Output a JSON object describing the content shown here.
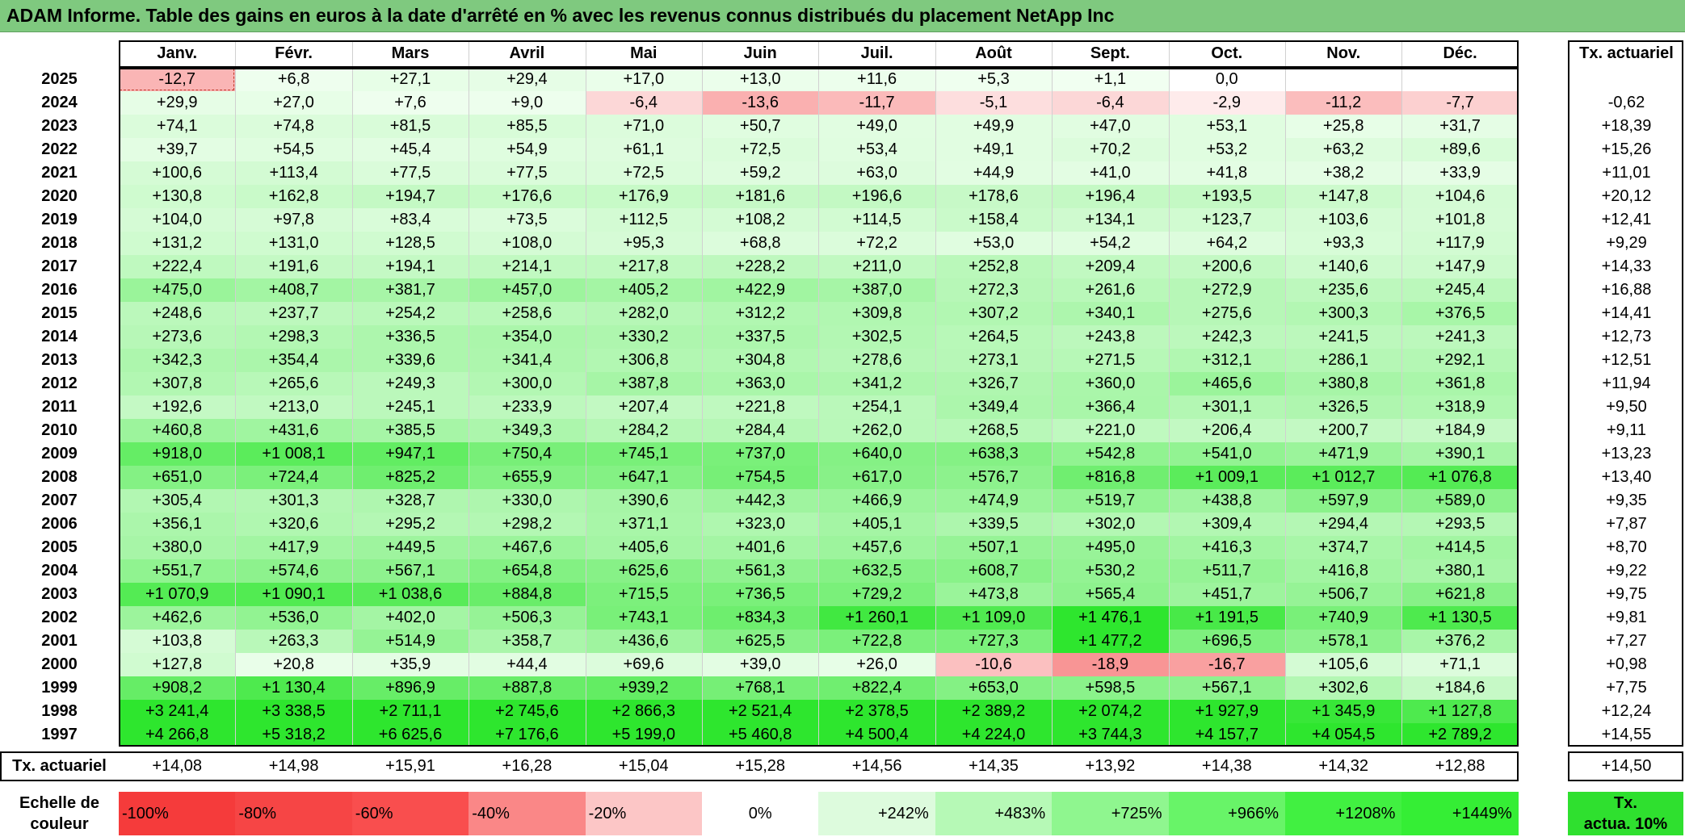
{
  "title": "ADAM Informe. Table des gains en euros à la date d'arrêté en % avec les revenus connus distribués du placement NetApp Inc",
  "months": [
    "Janv.",
    "Févr.",
    "Mars",
    "Avril",
    "Mai",
    "Juin",
    "Juil.",
    "Août",
    "Sept.",
    "Oct.",
    "Nov.",
    "Déc."
  ],
  "rate_header": "Tx. actuariel",
  "rows": [
    {
      "year": "2025",
      "values": [
        "-12,7",
        "+6,8",
        "+27,1",
        "+29,4",
        "+17,0",
        "+13,0",
        "+11,6",
        "+5,3",
        "+1,1",
        "0,0",
        "",
        ""
      ],
      "rate": ""
    },
    {
      "year": "2024",
      "values": [
        "+29,9",
        "+27,0",
        "+7,6",
        "+9,0",
        "-6,4",
        "-13,6",
        "-11,7",
        "-5,1",
        "-6,4",
        "-2,9",
        "-11,2",
        "-7,7"
      ],
      "rate": "-0,62"
    },
    {
      "year": "2023",
      "values": [
        "+74,1",
        "+74,8",
        "+81,5",
        "+85,5",
        "+71,0",
        "+50,7",
        "+49,0",
        "+49,9",
        "+47,0",
        "+53,1",
        "+25,8",
        "+31,7"
      ],
      "rate": "+18,39"
    },
    {
      "year": "2022",
      "values": [
        "+39,7",
        "+54,5",
        "+45,4",
        "+54,9",
        "+61,1",
        "+72,5",
        "+53,4",
        "+49,1",
        "+70,2",
        "+53,2",
        "+63,2",
        "+89,6"
      ],
      "rate": "+15,26"
    },
    {
      "year": "2021",
      "values": [
        "+100,6",
        "+113,4",
        "+77,5",
        "+77,5",
        "+72,5",
        "+59,2",
        "+63,0",
        "+44,9",
        "+41,0",
        "+41,8",
        "+38,2",
        "+33,9"
      ],
      "rate": "+11,01"
    },
    {
      "year": "2020",
      "values": [
        "+130,8",
        "+162,8",
        "+194,7",
        "+176,6",
        "+176,9",
        "+181,6",
        "+196,6",
        "+178,6",
        "+196,4",
        "+193,5",
        "+147,8",
        "+104,6"
      ],
      "rate": "+20,12"
    },
    {
      "year": "2019",
      "values": [
        "+104,0",
        "+97,8",
        "+83,4",
        "+73,5",
        "+112,5",
        "+108,2",
        "+114,5",
        "+158,4",
        "+134,1",
        "+123,7",
        "+103,6",
        "+101,8"
      ],
      "rate": "+12,41"
    },
    {
      "year": "2018",
      "values": [
        "+131,2",
        "+131,0",
        "+128,5",
        "+108,0",
        "+95,3",
        "+68,8",
        "+72,2",
        "+53,0",
        "+54,2",
        "+64,2",
        "+93,3",
        "+117,9"
      ],
      "rate": "+9,29"
    },
    {
      "year": "2017",
      "values": [
        "+222,4",
        "+191,6",
        "+194,1",
        "+214,1",
        "+217,8",
        "+228,2",
        "+211,0",
        "+252,8",
        "+209,4",
        "+200,6",
        "+140,6",
        "+147,9"
      ],
      "rate": "+14,33"
    },
    {
      "year": "2016",
      "values": [
        "+475,0",
        "+408,7",
        "+381,7",
        "+457,0",
        "+405,2",
        "+422,9",
        "+387,0",
        "+272,3",
        "+261,6",
        "+272,9",
        "+235,6",
        "+245,4"
      ],
      "rate": "+16,88"
    },
    {
      "year": "2015",
      "values": [
        "+248,6",
        "+237,7",
        "+254,2",
        "+258,6",
        "+282,0",
        "+312,2",
        "+309,8",
        "+307,2",
        "+340,1",
        "+275,6",
        "+300,3",
        "+376,5"
      ],
      "rate": "+14,41"
    },
    {
      "year": "2014",
      "values": [
        "+273,6",
        "+298,3",
        "+336,5",
        "+354,0",
        "+330,2",
        "+337,5",
        "+302,5",
        "+264,5",
        "+243,8",
        "+242,3",
        "+241,5",
        "+241,3"
      ],
      "rate": "+12,73"
    },
    {
      "year": "2013",
      "values": [
        "+342,3",
        "+354,4",
        "+339,6",
        "+341,4",
        "+306,8",
        "+304,8",
        "+278,6",
        "+273,1",
        "+271,5",
        "+312,1",
        "+286,1",
        "+292,1"
      ],
      "rate": "+12,51"
    },
    {
      "year": "2012",
      "values": [
        "+307,8",
        "+265,6",
        "+249,3",
        "+300,0",
        "+387,8",
        "+363,0",
        "+341,2",
        "+326,7",
        "+360,0",
        "+465,6",
        "+380,8",
        "+361,8"
      ],
      "rate": "+11,94"
    },
    {
      "year": "2011",
      "values": [
        "+192,6",
        "+213,0",
        "+245,1",
        "+233,9",
        "+207,4",
        "+221,8",
        "+254,1",
        "+349,4",
        "+366,4",
        "+301,1",
        "+326,5",
        "+318,9"
      ],
      "rate": "+9,50"
    },
    {
      "year": "2010",
      "values": [
        "+460,8",
        "+431,6",
        "+385,5",
        "+349,3",
        "+284,2",
        "+284,4",
        "+262,0",
        "+268,5",
        "+221,0",
        "+206,4",
        "+200,7",
        "+184,9"
      ],
      "rate": "+9,11"
    },
    {
      "year": "2009",
      "values": [
        "+918,0",
        "+1 008,1",
        "+947,1",
        "+750,4",
        "+745,1",
        "+737,0",
        "+640,0",
        "+638,3",
        "+542,8",
        "+541,0",
        "+471,9",
        "+390,1"
      ],
      "rate": "+13,23"
    },
    {
      "year": "2008",
      "values": [
        "+651,0",
        "+724,4",
        "+825,2",
        "+655,9",
        "+647,1",
        "+754,5",
        "+617,0",
        "+576,7",
        "+816,8",
        "+1 009,1",
        "+1 012,7",
        "+1 076,8"
      ],
      "rate": "+13,40"
    },
    {
      "year": "2007",
      "values": [
        "+305,4",
        "+301,3",
        "+328,7",
        "+330,0",
        "+390,6",
        "+442,3",
        "+466,9",
        "+474,9",
        "+519,7",
        "+438,8",
        "+597,9",
        "+589,0"
      ],
      "rate": "+9,35"
    },
    {
      "year": "2006",
      "values": [
        "+356,1",
        "+320,6",
        "+295,2",
        "+298,2",
        "+371,1",
        "+323,0",
        "+405,1",
        "+339,5",
        "+302,0",
        "+309,4",
        "+294,4",
        "+293,5"
      ],
      "rate": "+7,87"
    },
    {
      "year": "2005",
      "values": [
        "+380,0",
        "+417,9",
        "+449,5",
        "+467,6",
        "+405,6",
        "+401,6",
        "+457,6",
        "+507,1",
        "+495,0",
        "+416,3",
        "+374,7",
        "+414,5"
      ],
      "rate": "+8,70"
    },
    {
      "year": "2004",
      "values": [
        "+551,7",
        "+574,6",
        "+567,1",
        "+654,8",
        "+625,6",
        "+561,3",
        "+632,5",
        "+608,7",
        "+530,2",
        "+511,7",
        "+416,8",
        "+380,1"
      ],
      "rate": "+9,22"
    },
    {
      "year": "2003",
      "values": [
        "+1 070,9",
        "+1 090,1",
        "+1 038,6",
        "+884,8",
        "+715,5",
        "+736,5",
        "+729,2",
        "+473,8",
        "+565,4",
        "+451,7",
        "+506,7",
        "+621,8"
      ],
      "rate": "+9,75"
    },
    {
      "year": "2002",
      "values": [
        "+462,6",
        "+536,0",
        "+402,0",
        "+506,3",
        "+743,1",
        "+834,3",
        "+1 260,1",
        "+1 109,0",
        "+1 476,1",
        "+1 191,5",
        "+740,9",
        "+1 130,5"
      ],
      "rate": "+9,81"
    },
    {
      "year": "2001",
      "values": [
        "+103,8",
        "+263,3",
        "+514,9",
        "+358,7",
        "+436,6",
        "+625,5",
        "+722,8",
        "+727,3",
        "+1 477,2",
        "+696,5",
        "+578,1",
        "+376,2"
      ],
      "rate": "+7,27"
    },
    {
      "year": "2000",
      "values": [
        "+127,8",
        "+20,8",
        "+35,9",
        "+44,4",
        "+69,6",
        "+39,0",
        "+26,0",
        "-10,6",
        "-18,9",
        "-16,7",
        "+105,6",
        "+71,1"
      ],
      "rate": "+0,98"
    },
    {
      "year": "1999",
      "values": [
        "+908,2",
        "+1 130,4",
        "+896,9",
        "+887,8",
        "+939,2",
        "+768,1",
        "+822,4",
        "+653,0",
        "+598,5",
        "+567,1",
        "+302,6",
        "+184,6"
      ],
      "rate": "+7,75"
    },
    {
      "year": "1998",
      "values": [
        "+3 241,4",
        "+3 338,5",
        "+2 711,1",
        "+2 745,6",
        "+2 866,3",
        "+2 521,4",
        "+2 378,5",
        "+2 389,2",
        "+2 074,2",
        "+1 927,9",
        "+1 345,9",
        "+1 127,8"
      ],
      "rate": "+12,24"
    },
    {
      "year": "1997",
      "values": [
        "+4 266,8",
        "+5 318,2",
        "+6 625,6",
        "+7 176,6",
        "+5 199,0",
        "+5 460,8",
        "+4 500,4",
        "+4 224,0",
        "+3 744,3",
        "+4 157,7",
        "+4 054,5",
        "+2 789,2"
      ],
      "rate": "+14,55"
    }
  ],
  "footer": {
    "label": "Tx. actuariel",
    "values": [
      "+14,08",
      "+14,98",
      "+15,91",
      "+16,28",
      "+15,04",
      "+15,28",
      "+14,56",
      "+14,35",
      "+13,92",
      "+14,38",
      "+14,32",
      "+12,88"
    ],
    "rate": "+14,50"
  },
  "legend": {
    "title_line1": "Echelle de",
    "title_line2": "couleur",
    "scale": [
      "-100%",
      "-80%",
      "-60%",
      "-40%",
      "-20%",
      "0%",
      "+242%",
      "+483%",
      "+725%",
      "+966%",
      "+1208%",
      "+1449%"
    ],
    "scale_colors": [
      "#f53b3b",
      "#f64545",
      "#f94e4e",
      "#fa8787",
      "#fcc6c6",
      "#ffffff",
      "#ddfbdd",
      "#b6f9b6",
      "#8ff68f",
      "#68f468",
      "#41f041",
      "#35ee35"
    ],
    "rate_box_line1": "Tx.",
    "rate_box_line2": "actua. 10%",
    "rate_box_color": "#2fe02f"
  },
  "colors": {
    "title_bar": "#7fc97f",
    "max_green": "#2ee62e",
    "max_red": "#f54343"
  }
}
